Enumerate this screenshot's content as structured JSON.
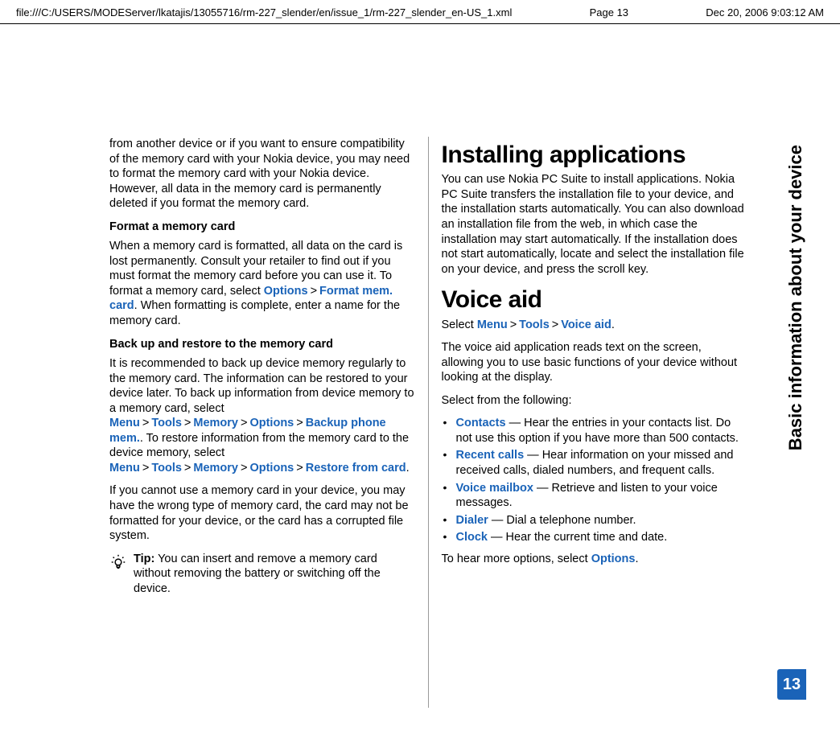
{
  "header": {
    "path": "file:///C:/USERS/MODEServer/lkatajis/13055716/rm-227_slender/en/issue_1/rm-227_slender_en-US_1.xml",
    "page_label": "Page 13",
    "timestamp": "Dec 20, 2006 9:03:12 AM"
  },
  "side": {
    "caption": "Basic information about your device",
    "page_number": "13"
  },
  "left": {
    "intro": "from another device or if you want to ensure compatibility of the memory card with your Nokia device, you may need to format the memory card with your Nokia device. However, all data in the memory card is permanently deleted if you format the memory card.",
    "format_head": "Format a memory card",
    "format_body_pre": "When a memory card is formatted, all data on the card is lost permanently. Consult your retailer to find out if you must format the memory card before you can use it. To format a memory card, select ",
    "format_opt1": "Options",
    "format_opt2": "Format mem. card",
    "format_body_post": ". When formatting is complete, enter a name for the memory card.",
    "backup_head": "Back up and restore to the memory card",
    "backup_p1_pre": "It is recommended to back up device memory regularly to the memory card. The information can be restored to your device later. To back up information from device memory to a memory card, select ",
    "menu": "Menu",
    "tools": "Tools",
    "memory": "Memory",
    "options": "Options",
    "backup": "Backup phone mem.",
    "backup_p1_mid": ". To restore information from the memory card to the device memory, select ",
    "restore": "Restore from card",
    "backup_p1_end": ".",
    "backup_p2": "If you cannot use a memory card in your device, you may have the wrong type of memory card, the card may not be formatted for your device, or the card has a corrupted file system.",
    "tip_label": "Tip:",
    "tip_text": "  You can insert and remove a memory card without removing the battery or switching off the device."
  },
  "right": {
    "h_installing": "Installing applications",
    "install_body": "You can use Nokia PC Suite to install applications. Nokia PC Suite transfers the installation file to your device, and the installation starts automatically. You can also download an installation file from the web, in which case the installation may start automatically. If the installation does not start automatically, locate and select the installation file on your device, and press the scroll key.",
    "h_voice": "Voice aid",
    "voice_select_pre": "Select ",
    "menu": "Menu",
    "tools": "Tools",
    "voiceaid": "Voice aid",
    "voice_select_post": ".",
    "voice_desc": "The voice aid application reads text on the screen, allowing you to use basic functions of your device without looking at the display.",
    "voice_select_from": "Select from the following:",
    "items": {
      "contacts": {
        "label": "Contacts",
        "text": " — Hear the entries in your contacts list. Do not use this option if you have more than 500 contacts."
      },
      "recent": {
        "label": "Recent calls",
        "text": " — Hear information on your missed and received calls, dialed numbers, and frequent calls."
      },
      "voicemb": {
        "label": "Voice mailbox",
        "text": " — Retrieve and listen to your voice messages."
      },
      "dialer": {
        "label": "Dialer",
        "text": " — Dial a telephone number."
      },
      "clock": {
        "label": "Clock",
        "text": " — Hear the current time and date."
      }
    },
    "more_pre": "To hear more options, select ",
    "more_opt": "Options",
    "more_post": "."
  }
}
